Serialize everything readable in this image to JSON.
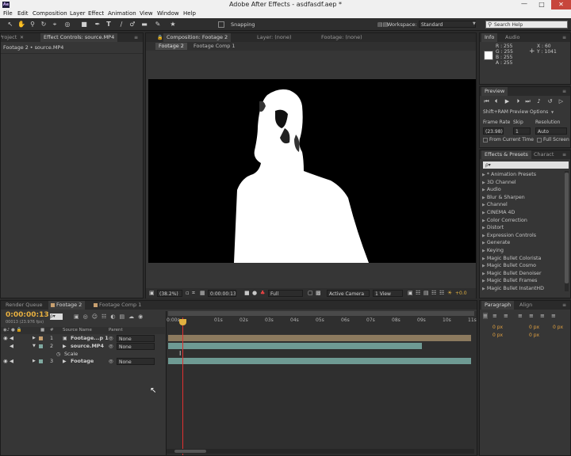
{
  "window": {
    "title": "Adobe After Effects - asdfasdf.aep *",
    "app_icon": "Ae"
  },
  "menu": [
    "File",
    "Edit",
    "Composition",
    "Layer",
    "Effect",
    "Animation",
    "View",
    "Window",
    "Help"
  ],
  "toolbar": {
    "snapping_label": "Snapping",
    "workspace_label": "Workspace:",
    "workspace_value": "Standard",
    "search_help_placeholder": "Search Help"
  },
  "left_panel": {
    "tabs": [
      "Project",
      "Effect Controls: source.MP4"
    ],
    "breadcrumb": "Footage 2 • source.MP4"
  },
  "viewer": {
    "tabs": [
      "Composition: Footage 2",
      "Layer: (none)",
      "Footage: (none)"
    ],
    "subtabs": [
      "Footage 2",
      "Footage Comp 1"
    ],
    "zoom": "(38.2%)",
    "timecode": "0:00:00:13",
    "resolution": "Full",
    "camera": "Active Camera",
    "view": "1 View",
    "exposure": "+0.0"
  },
  "info": {
    "tabs": [
      "Info",
      "Audio"
    ],
    "r": "R : 255",
    "g": "G : 255",
    "b": "B : 255",
    "a": "A : 255",
    "x": "X : 60",
    "y": "Y : 1041",
    "swatch_color": "#ffffff"
  },
  "preview": {
    "tab": "Preview",
    "ram_options": "Shift+RAM Preview Options",
    "frame_rate_label": "Frame Rate",
    "skip_label": "Skip",
    "resolution_label": "Resolution",
    "frame_rate_value": "(23.98)",
    "skip_value": "1",
    "resolution_value": "Auto",
    "from_current_time": "From Current Time",
    "full_screen": "Full Screen"
  },
  "effects": {
    "tabs": [
      "Effects & Presets",
      "Charact"
    ],
    "search_placeholder": "ρ▾",
    "items": [
      "* Animation Presets",
      "3D Channel",
      "Audio",
      "Blur & Sharpen",
      "Channel",
      "CINEMA 4D",
      "Color Correction",
      "Distort",
      "Expression Controls",
      "Generate",
      "Keying",
      "Magic Bullet Colorista",
      "Magic Bullet Cosmo",
      "Magic Bullet Denoiser",
      "Magic Bullet Frames",
      "Magic Bullet InstantHD"
    ]
  },
  "paragraph": {
    "tabs": [
      "Paragraph",
      "Align"
    ],
    "values": [
      "0 px",
      "0 px",
      "0 px",
      "0 px",
      "0 px"
    ]
  },
  "timeline": {
    "tabs": [
      "Render Queue",
      "Footage 2",
      "Footage Comp 1"
    ],
    "timecode": "0:00:00:13",
    "frames": "00013 (23.976 fps)",
    "col_num": "#",
    "col_source": "Source Name",
    "col_parent": "Parent",
    "ruler": [
      "0:00s",
      "01s",
      "02s",
      "03s",
      "04s",
      "05s",
      "06s",
      "07s",
      "08s",
      "09s",
      "10s",
      "11s"
    ],
    "layers": [
      {
        "num": "1",
        "name": "Footage...p 1",
        "parent": "None",
        "label_color": "#c8a070",
        "bar_color": "#8c7a5e"
      },
      {
        "num": "2",
        "name": "source.MP4",
        "parent": "None",
        "label_color": "#7fa9a0",
        "bar_color": "#6e9a93"
      },
      {
        "num": "3",
        "name": "Footage",
        "parent": "None",
        "label_color": "#7fa9a0",
        "bar_color": "#6e9a93"
      }
    ],
    "property": "Scale",
    "playhead_fraction": 0.054
  }
}
